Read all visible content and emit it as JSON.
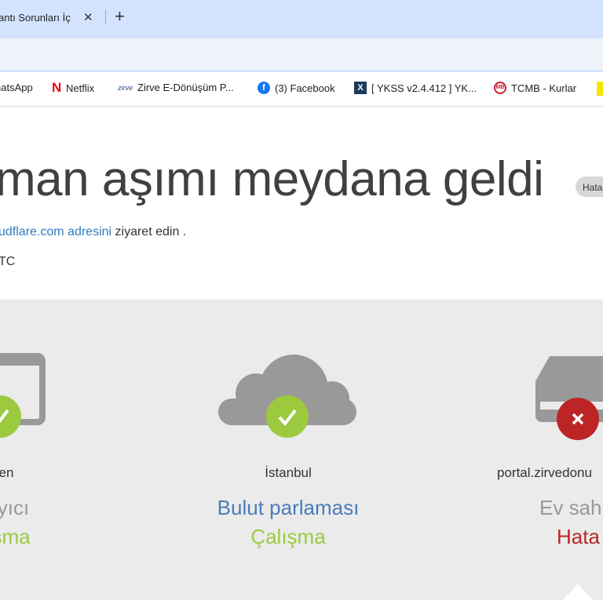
{
  "browser": {
    "tab_title": "antı Sorunları İç",
    "close_tab": "✕",
    "new_tab": "+",
    "bookmarks": [
      {
        "label": "hatsApp",
        "icon": "whatsapp-icon"
      },
      {
        "label": "Netflix",
        "icon": "netflix-icon"
      },
      {
        "label": "Zirve E-Dönüşüm P...",
        "icon": "zirve-icon",
        "icon_text": "zirve"
      },
      {
        "label": "(3) Facebook",
        "icon": "facebook-icon"
      },
      {
        "label": "[ YKSS v2.4.412 ] YK...",
        "icon": "ykss-icon"
      },
      {
        "label": "TCMB - Kurlar",
        "icon": "tcmb-icon"
      }
    ]
  },
  "page": {
    "title": "man aşımı meydana geldi",
    "badge": "Hata",
    "link_text": "udflare.com adresini",
    "after_link": " ziyaret edin .",
    "time_suffix": "TC"
  },
  "nodes": [
    {
      "location": "en",
      "role": "yıcı",
      "status": "şma",
      "state": "ok"
    },
    {
      "location": "İstanbul",
      "role": "Bulut parlaması",
      "status": "Çalışma",
      "state": "ok"
    },
    {
      "location": "portal.zirvedonu",
      "role": "Ev sahi",
      "status": "Hata",
      "state": "error"
    }
  ],
  "colors": {
    "ok": "#9bca3e",
    "error": "#bd2426",
    "link": "#2f7bbf",
    "icon_gray": "#999999"
  }
}
